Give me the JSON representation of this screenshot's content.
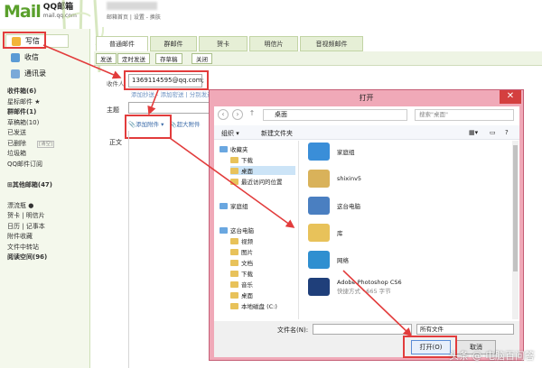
{
  "header": {
    "logo_main": "Mail",
    "logo_cn": "QQ邮箱",
    "logo_domain": "mail.qq.com",
    "top_links": "邮箱首页 | 设置 - 换肤"
  },
  "sidebar": {
    "write": "写信",
    "receive": "收信",
    "contacts": "通讯录",
    "folders": [
      {
        "label": "收件箱(6)",
        "bold": true
      },
      {
        "label": "星标邮件 ★",
        "bold": false
      },
      {
        "label": "群邮件(1)",
        "bold": true
      },
      {
        "label": "草稿箱(10)",
        "bold": false
      },
      {
        "label": "已发送",
        "bold": false
      },
      {
        "label": "已删除",
        "bold": false,
        "extra": "[清空]"
      },
      {
        "label": "垃圾箱",
        "bold": false
      },
      {
        "label": "QQ邮件订阅",
        "bold": false
      },
      {
        "label": "",
        "bold": false
      },
      {
        "label": "⊞其他邮箱(47)",
        "bold": true
      },
      {
        "label": "",
        "bold": false
      },
      {
        "label": "漂流瓶 ●",
        "bold": false
      },
      {
        "label": "贺卡 | 明信片",
        "bold": false
      },
      {
        "label": "日历 | 记事本",
        "bold": false
      },
      {
        "label": "附件收藏",
        "bold": false
      },
      {
        "label": "文件中转站",
        "bold": false
      },
      {
        "label": "阅读空间(96)",
        "bold": true
      }
    ]
  },
  "compose": {
    "tabs": [
      "普通邮件",
      "群邮件",
      "贺卡",
      "明信片",
      "音视频邮件"
    ],
    "actions": [
      "发送",
      "定时发送",
      "存草稿",
      "关闭"
    ],
    "to_label": "收件人",
    "to_value": "1369114595@qq.com;",
    "to_links": "添加抄送 - 添加密送 | 分别发送",
    "subject_label": "主题",
    "attach_label": "添加附件",
    "big_attach_label": "超大附件",
    "body_label": "正文"
  },
  "dialog": {
    "title": "打开",
    "close": "✕",
    "path": "桌面",
    "search_placeholder": "搜索\"桌面\"",
    "organize": "组织 ▾",
    "new_folder": "新建文件夹",
    "nav": [
      {
        "label": "收藏夹",
        "indent": 0,
        "selected": false
      },
      {
        "label": "下载",
        "indent": 1,
        "selected": false
      },
      {
        "label": "桌面",
        "indent": 1,
        "selected": true
      },
      {
        "label": "最近访问的位置",
        "indent": 1,
        "selected": false
      },
      {
        "label": "家庭组",
        "indent": 0,
        "selected": false
      },
      {
        "label": "这台电脑",
        "indent": 0,
        "selected": false
      },
      {
        "label": "视频",
        "indent": 1,
        "selected": false
      },
      {
        "label": "图片",
        "indent": 1,
        "selected": false
      },
      {
        "label": "文档",
        "indent": 1,
        "selected": false
      },
      {
        "label": "下载",
        "indent": 1,
        "selected": false
      },
      {
        "label": "音乐",
        "indent": 1,
        "selected": false
      },
      {
        "label": "桌面",
        "indent": 1,
        "selected": false
      },
      {
        "label": "本地磁盘 (C:)",
        "indent": 1,
        "selected": false
      }
    ],
    "files": [
      {
        "name": "家庭组",
        "sub": ""
      },
      {
        "name": "shixinv5",
        "sub": ""
      },
      {
        "name": "这台电脑",
        "sub": ""
      },
      {
        "name": "库",
        "sub": ""
      },
      {
        "name": "网络",
        "sub": ""
      },
      {
        "name": "Adobe Photoshop CS6",
        "sub": "快捷方式 · 665 字节"
      }
    ],
    "filename_label": "文件名(N):",
    "filetype": "所有文件",
    "open": "打开(O)",
    "cancel": "取消"
  },
  "watermark": "头条 @ 电脑百问答"
}
